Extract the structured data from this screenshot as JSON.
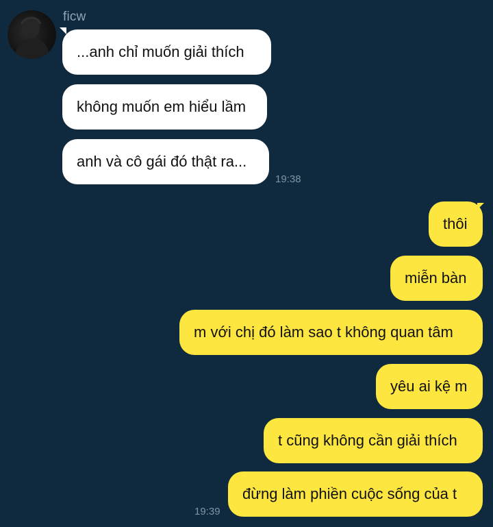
{
  "contact": {
    "name": "ficw",
    "avatar_icon": "avatar-photo"
  },
  "incoming": {
    "messages": [
      "...anh chỉ muốn giải thích",
      "không muốn em hiểu lầm",
      "anh và cô gái đó thật ra..."
    ],
    "time": "19:38"
  },
  "outgoing": {
    "messages": [
      "thôi",
      "miễn bàn",
      "m với chị đó làm sao t không quan tâm",
      "yêu ai kệ m",
      "t cũng không cần giải thích",
      "đừng làm phiền cuộc sống của t"
    ],
    "time": "19:39"
  },
  "colors": {
    "background": "#0f2a3e",
    "incoming_bubble": "#ffffff",
    "outgoing_bubble": "#fde63f",
    "meta_text": "#7f95a6"
  }
}
